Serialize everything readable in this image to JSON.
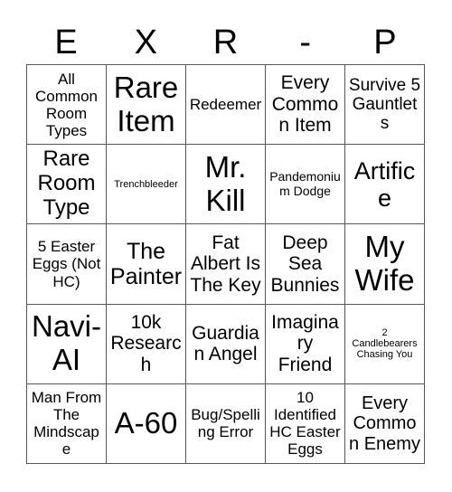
{
  "card": {
    "header_letters": [
      "E",
      "X",
      "R",
      "-",
      "P"
    ],
    "columns": 5,
    "rows": 5,
    "background_color": "#ffffff",
    "text_color": "#000000",
    "border_color": "#555555",
    "cells": [
      {
        "text": "All Common Room Types",
        "size": "md"
      },
      {
        "text": "Rare Item",
        "size": "xxl"
      },
      {
        "text": "Redeemer",
        "size": "md"
      },
      {
        "text": "Every Common Item",
        "size": "lg"
      },
      {
        "text": "Survive 5 Gauntlets",
        "size": "lg"
      },
      {
        "text": "Rare Room Type",
        "size": "xl"
      },
      {
        "text": "Trenchbleeder",
        "size": "xs"
      },
      {
        "text": "Mr. Kill",
        "size": "xxl"
      },
      {
        "text": "Pandemonium Dodge",
        "size": "sm"
      },
      {
        "text": "Artifice",
        "size": "xl"
      },
      {
        "text": "5 Easter Eggs (Not HC)",
        "size": "md"
      },
      {
        "text": "The Painter",
        "size": "xl"
      },
      {
        "text": "Fat Albert Is The Key",
        "size": "lg"
      },
      {
        "text": "Deep Sea Bunnies",
        "size": "lg"
      },
      {
        "text": "My Wife",
        "size": "xxl"
      },
      {
        "text": "Navi-AI",
        "size": "xxl"
      },
      {
        "text": "10k Research",
        "size": "lg"
      },
      {
        "text": "Guardian Angel",
        "size": "lg"
      },
      {
        "text": "Imaginary Friend",
        "size": "lg"
      },
      {
        "text": "2 Candlebearers Chasing You",
        "size": "xs"
      },
      {
        "text": "Man From The Mindscape",
        "size": "md"
      },
      {
        "text": "A-60",
        "size": "xxl"
      },
      {
        "text": "Bug/Spelling Error",
        "size": "md"
      },
      {
        "text": "10 Identified HC Easter Eggs",
        "size": "md"
      },
      {
        "text": "Every Common Enemy",
        "size": "lg"
      }
    ]
  }
}
